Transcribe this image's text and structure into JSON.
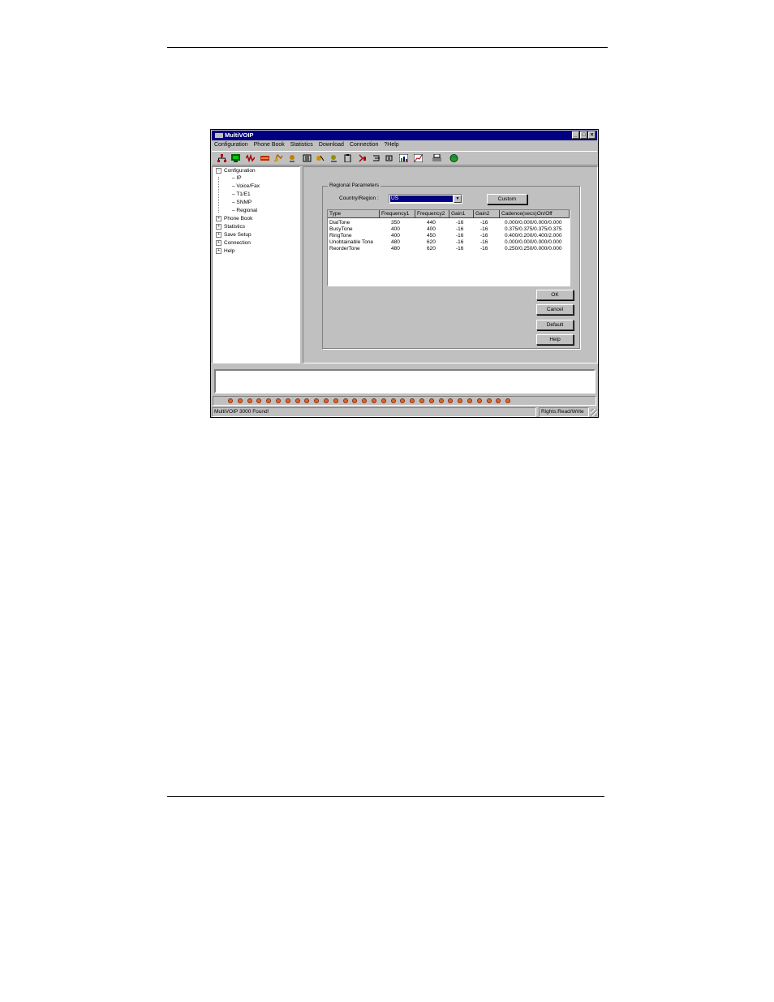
{
  "window": {
    "title": "MultiVOIP",
    "controls": {
      "minimize": "_",
      "maximize": "□",
      "close": "×"
    }
  },
  "menu": [
    "Configuration",
    "Phone Book",
    "Statistics",
    "Download",
    "Connection",
    "?Help"
  ],
  "toolbar_icons": [
    "network-icon",
    "monitor-icon",
    "waveform-icon",
    "t1-icon",
    "snmp-icon",
    "phonebook-icon",
    "stats-icon",
    "call-icon",
    "save-icon",
    "clipboard-icon",
    "download-icon",
    "connect-icon",
    "upload-icon",
    "chart-icon",
    "graph-icon",
    "printer-icon",
    "globe-icon"
  ],
  "tree": {
    "configuration": {
      "label": "Configuration",
      "toggle": "−",
      "children": [
        "IP",
        "Voice/Fax",
        "T1/E1",
        "SNMP",
        "Regional"
      ]
    },
    "others": [
      {
        "label": "Phone Book",
        "toggle": "+"
      },
      {
        "label": "Statistics",
        "toggle": "+"
      },
      {
        "label": "Save Setup",
        "toggle": "+"
      },
      {
        "label": "Connection",
        "toggle": "+"
      },
      {
        "label": "Help",
        "toggle": "+"
      }
    ]
  },
  "regional": {
    "group_label": "Regional Parameters",
    "country_label": "Country/Region :",
    "country_value": "US",
    "dropdown_arrow": "▼",
    "custom_button": "Custom",
    "columns": [
      "Type",
      "Frequency1",
      "Frequency2",
      "Gain1",
      "Gain2",
      "Cadence(secs)On/Off"
    ],
    "rows": [
      [
        "DialTone",
        "350",
        "440",
        "-16",
        "-16",
        "0.000/0.000/0.000/0.000"
      ],
      [
        "BusyTone",
        "400",
        "400",
        "-16",
        "-16",
        "0.375/0.375/0.375/0.375"
      ],
      [
        "RingTone",
        "400",
        "450",
        "-16",
        "-16",
        "0.400/0.200/0.400/2.000"
      ],
      [
        "Unobtainable Tone",
        "480",
        "620",
        "-16",
        "-16",
        "0.000/0.000/0.000/0.000"
      ],
      [
        "ReorderTone",
        "480",
        "620",
        "-16",
        "-16",
        "0.250/0.250/0.000/0.000"
      ]
    ],
    "buttons": {
      "ok": "OK",
      "cancel": "Cancel",
      "default": "Default",
      "help": "Help"
    }
  },
  "led_count": 30,
  "led_color": "#e8642a",
  "statusbar": {
    "left": "MultiVOIP 3000 Found!",
    "right": "Rights:Read/Write"
  }
}
